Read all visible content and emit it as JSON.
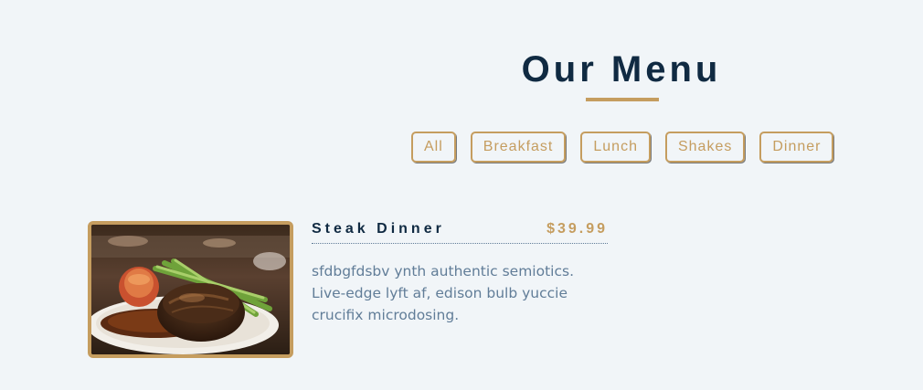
{
  "section": {
    "title": "Our Menu"
  },
  "filters": [
    {
      "label": "All"
    },
    {
      "label": "Breakfast"
    },
    {
      "label": "Lunch"
    },
    {
      "label": "Shakes"
    },
    {
      "label": "Dinner"
    }
  ],
  "items": [
    {
      "name": "Steak Dinner",
      "price": "$39.99",
      "description": "sfdbgfdsbv ynth authentic semiotics. Live-edge lyft af, edison bulb yuccie crucifix microdosing."
    }
  ],
  "colors": {
    "background": "#f1f5f8",
    "accent": "#c59d5f",
    "heading": "#102a42",
    "text": "#617d98"
  }
}
